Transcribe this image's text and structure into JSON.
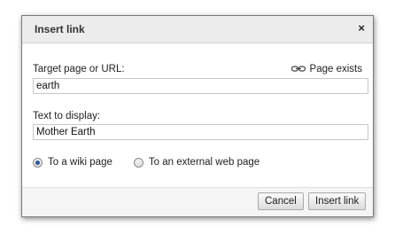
{
  "dialog": {
    "title": "Insert link",
    "close_label": "×"
  },
  "target": {
    "label": "Target page or URL:",
    "value": "earth",
    "status_text": "Page exists",
    "status_icon": "link-chain-icon"
  },
  "display": {
    "label": "Text to display:",
    "value": "Mother Earth"
  },
  "link_type": {
    "options": [
      {
        "label": "To a wiki page",
        "selected": true
      },
      {
        "label": "To an external web page",
        "selected": false
      }
    ]
  },
  "buttons": {
    "cancel": "Cancel",
    "insert": "Insert link"
  }
}
